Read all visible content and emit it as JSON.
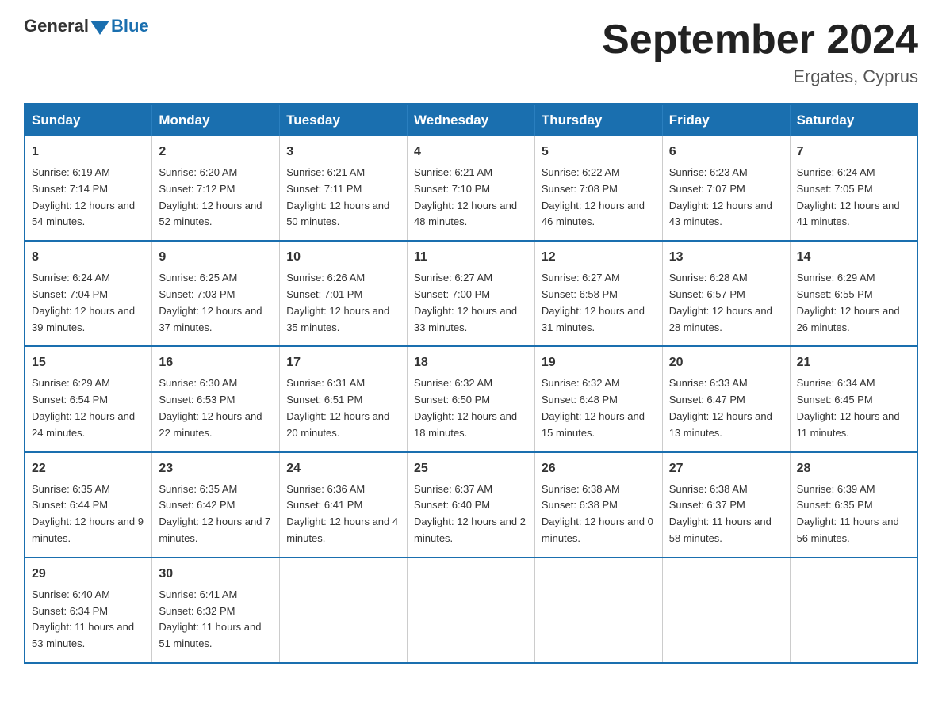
{
  "logo": {
    "general": "General",
    "blue": "Blue"
  },
  "title": "September 2024",
  "subtitle": "Ergates, Cyprus",
  "days_of_week": [
    "Sunday",
    "Monday",
    "Tuesday",
    "Wednesday",
    "Thursday",
    "Friday",
    "Saturday"
  ],
  "weeks": [
    [
      {
        "day": "1",
        "sunrise": "Sunrise: 6:19 AM",
        "sunset": "Sunset: 7:14 PM",
        "daylight": "Daylight: 12 hours and 54 minutes."
      },
      {
        "day": "2",
        "sunrise": "Sunrise: 6:20 AM",
        "sunset": "Sunset: 7:12 PM",
        "daylight": "Daylight: 12 hours and 52 minutes."
      },
      {
        "day": "3",
        "sunrise": "Sunrise: 6:21 AM",
        "sunset": "Sunset: 7:11 PM",
        "daylight": "Daylight: 12 hours and 50 minutes."
      },
      {
        "day": "4",
        "sunrise": "Sunrise: 6:21 AM",
        "sunset": "Sunset: 7:10 PM",
        "daylight": "Daylight: 12 hours and 48 minutes."
      },
      {
        "day": "5",
        "sunrise": "Sunrise: 6:22 AM",
        "sunset": "Sunset: 7:08 PM",
        "daylight": "Daylight: 12 hours and 46 minutes."
      },
      {
        "day": "6",
        "sunrise": "Sunrise: 6:23 AM",
        "sunset": "Sunset: 7:07 PM",
        "daylight": "Daylight: 12 hours and 43 minutes."
      },
      {
        "day": "7",
        "sunrise": "Sunrise: 6:24 AM",
        "sunset": "Sunset: 7:05 PM",
        "daylight": "Daylight: 12 hours and 41 minutes."
      }
    ],
    [
      {
        "day": "8",
        "sunrise": "Sunrise: 6:24 AM",
        "sunset": "Sunset: 7:04 PM",
        "daylight": "Daylight: 12 hours and 39 minutes."
      },
      {
        "day": "9",
        "sunrise": "Sunrise: 6:25 AM",
        "sunset": "Sunset: 7:03 PM",
        "daylight": "Daylight: 12 hours and 37 minutes."
      },
      {
        "day": "10",
        "sunrise": "Sunrise: 6:26 AM",
        "sunset": "Sunset: 7:01 PM",
        "daylight": "Daylight: 12 hours and 35 minutes."
      },
      {
        "day": "11",
        "sunrise": "Sunrise: 6:27 AM",
        "sunset": "Sunset: 7:00 PM",
        "daylight": "Daylight: 12 hours and 33 minutes."
      },
      {
        "day": "12",
        "sunrise": "Sunrise: 6:27 AM",
        "sunset": "Sunset: 6:58 PM",
        "daylight": "Daylight: 12 hours and 31 minutes."
      },
      {
        "day": "13",
        "sunrise": "Sunrise: 6:28 AM",
        "sunset": "Sunset: 6:57 PM",
        "daylight": "Daylight: 12 hours and 28 minutes."
      },
      {
        "day": "14",
        "sunrise": "Sunrise: 6:29 AM",
        "sunset": "Sunset: 6:55 PM",
        "daylight": "Daylight: 12 hours and 26 minutes."
      }
    ],
    [
      {
        "day": "15",
        "sunrise": "Sunrise: 6:29 AM",
        "sunset": "Sunset: 6:54 PM",
        "daylight": "Daylight: 12 hours and 24 minutes."
      },
      {
        "day": "16",
        "sunrise": "Sunrise: 6:30 AM",
        "sunset": "Sunset: 6:53 PM",
        "daylight": "Daylight: 12 hours and 22 minutes."
      },
      {
        "day": "17",
        "sunrise": "Sunrise: 6:31 AM",
        "sunset": "Sunset: 6:51 PM",
        "daylight": "Daylight: 12 hours and 20 minutes."
      },
      {
        "day": "18",
        "sunrise": "Sunrise: 6:32 AM",
        "sunset": "Sunset: 6:50 PM",
        "daylight": "Daylight: 12 hours and 18 minutes."
      },
      {
        "day": "19",
        "sunrise": "Sunrise: 6:32 AM",
        "sunset": "Sunset: 6:48 PM",
        "daylight": "Daylight: 12 hours and 15 minutes."
      },
      {
        "day": "20",
        "sunrise": "Sunrise: 6:33 AM",
        "sunset": "Sunset: 6:47 PM",
        "daylight": "Daylight: 12 hours and 13 minutes."
      },
      {
        "day": "21",
        "sunrise": "Sunrise: 6:34 AM",
        "sunset": "Sunset: 6:45 PM",
        "daylight": "Daylight: 12 hours and 11 minutes."
      }
    ],
    [
      {
        "day": "22",
        "sunrise": "Sunrise: 6:35 AM",
        "sunset": "Sunset: 6:44 PM",
        "daylight": "Daylight: 12 hours and 9 minutes."
      },
      {
        "day": "23",
        "sunrise": "Sunrise: 6:35 AM",
        "sunset": "Sunset: 6:42 PM",
        "daylight": "Daylight: 12 hours and 7 minutes."
      },
      {
        "day": "24",
        "sunrise": "Sunrise: 6:36 AM",
        "sunset": "Sunset: 6:41 PM",
        "daylight": "Daylight: 12 hours and 4 minutes."
      },
      {
        "day": "25",
        "sunrise": "Sunrise: 6:37 AM",
        "sunset": "Sunset: 6:40 PM",
        "daylight": "Daylight: 12 hours and 2 minutes."
      },
      {
        "day": "26",
        "sunrise": "Sunrise: 6:38 AM",
        "sunset": "Sunset: 6:38 PM",
        "daylight": "Daylight: 12 hours and 0 minutes."
      },
      {
        "day": "27",
        "sunrise": "Sunrise: 6:38 AM",
        "sunset": "Sunset: 6:37 PM",
        "daylight": "Daylight: 11 hours and 58 minutes."
      },
      {
        "day": "28",
        "sunrise": "Sunrise: 6:39 AM",
        "sunset": "Sunset: 6:35 PM",
        "daylight": "Daylight: 11 hours and 56 minutes."
      }
    ],
    [
      {
        "day": "29",
        "sunrise": "Sunrise: 6:40 AM",
        "sunset": "Sunset: 6:34 PM",
        "daylight": "Daylight: 11 hours and 53 minutes."
      },
      {
        "day": "30",
        "sunrise": "Sunrise: 6:41 AM",
        "sunset": "Sunset: 6:32 PM",
        "daylight": "Daylight: 11 hours and 51 minutes."
      },
      null,
      null,
      null,
      null,
      null
    ]
  ]
}
